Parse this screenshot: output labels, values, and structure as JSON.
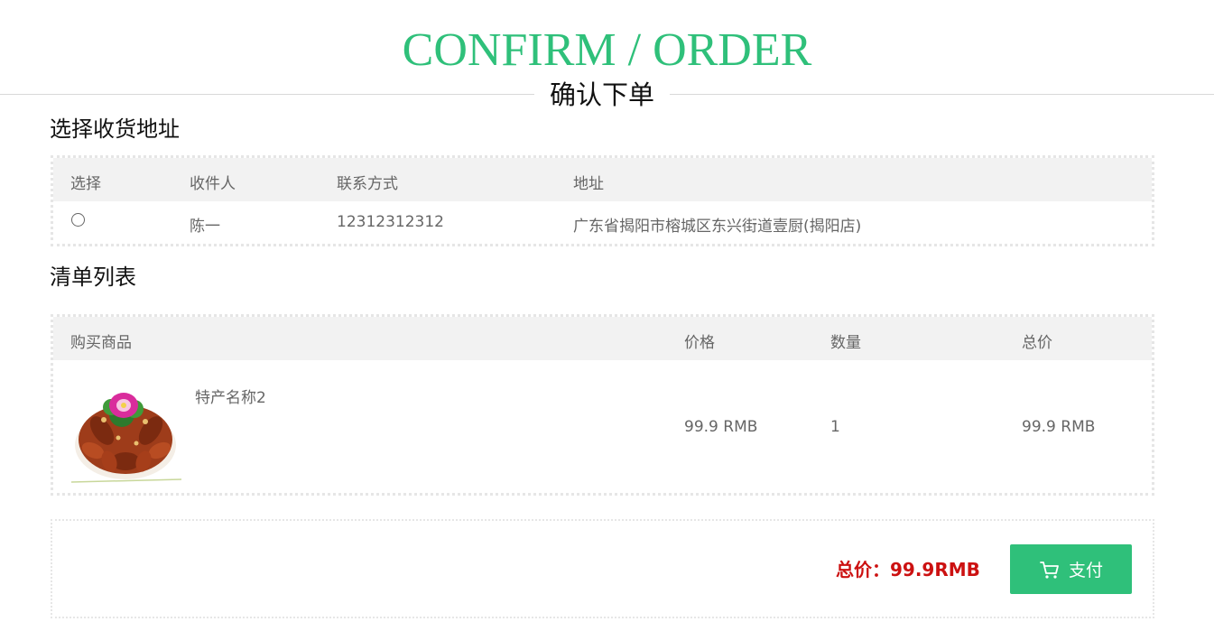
{
  "hero": {
    "title": "CONFIRM / ORDER",
    "subtitle": "确认下单"
  },
  "address": {
    "section_title": "选择收货地址",
    "headers": [
      "选择",
      "收件人",
      "联系方式",
      "地址"
    ],
    "rows": [
      {
        "selected": false,
        "recipient": "陈一",
        "phone": "12312312312",
        "address": "广东省揭阳市榕城区东兴街道壹厨(揭阳店)"
      }
    ]
  },
  "cart": {
    "section_title": "清单列表",
    "headers": [
      "购买商品",
      "价格",
      "数量",
      "总价"
    ],
    "rows": [
      {
        "name": "特产名称2",
        "price": "99.9 RMB",
        "quantity": "1",
        "total": "99.9 RMB",
        "image_icon": "braised-food-dish-image"
      }
    ]
  },
  "summary": {
    "total_text": "总价：99.9RMB",
    "pay_label": "支付",
    "pay_icon": "shopping-cart-icon"
  },
  "colors": {
    "accent": "#2fc07a",
    "total_red": "#cc1111",
    "header_bg": "#f2f2f2"
  }
}
